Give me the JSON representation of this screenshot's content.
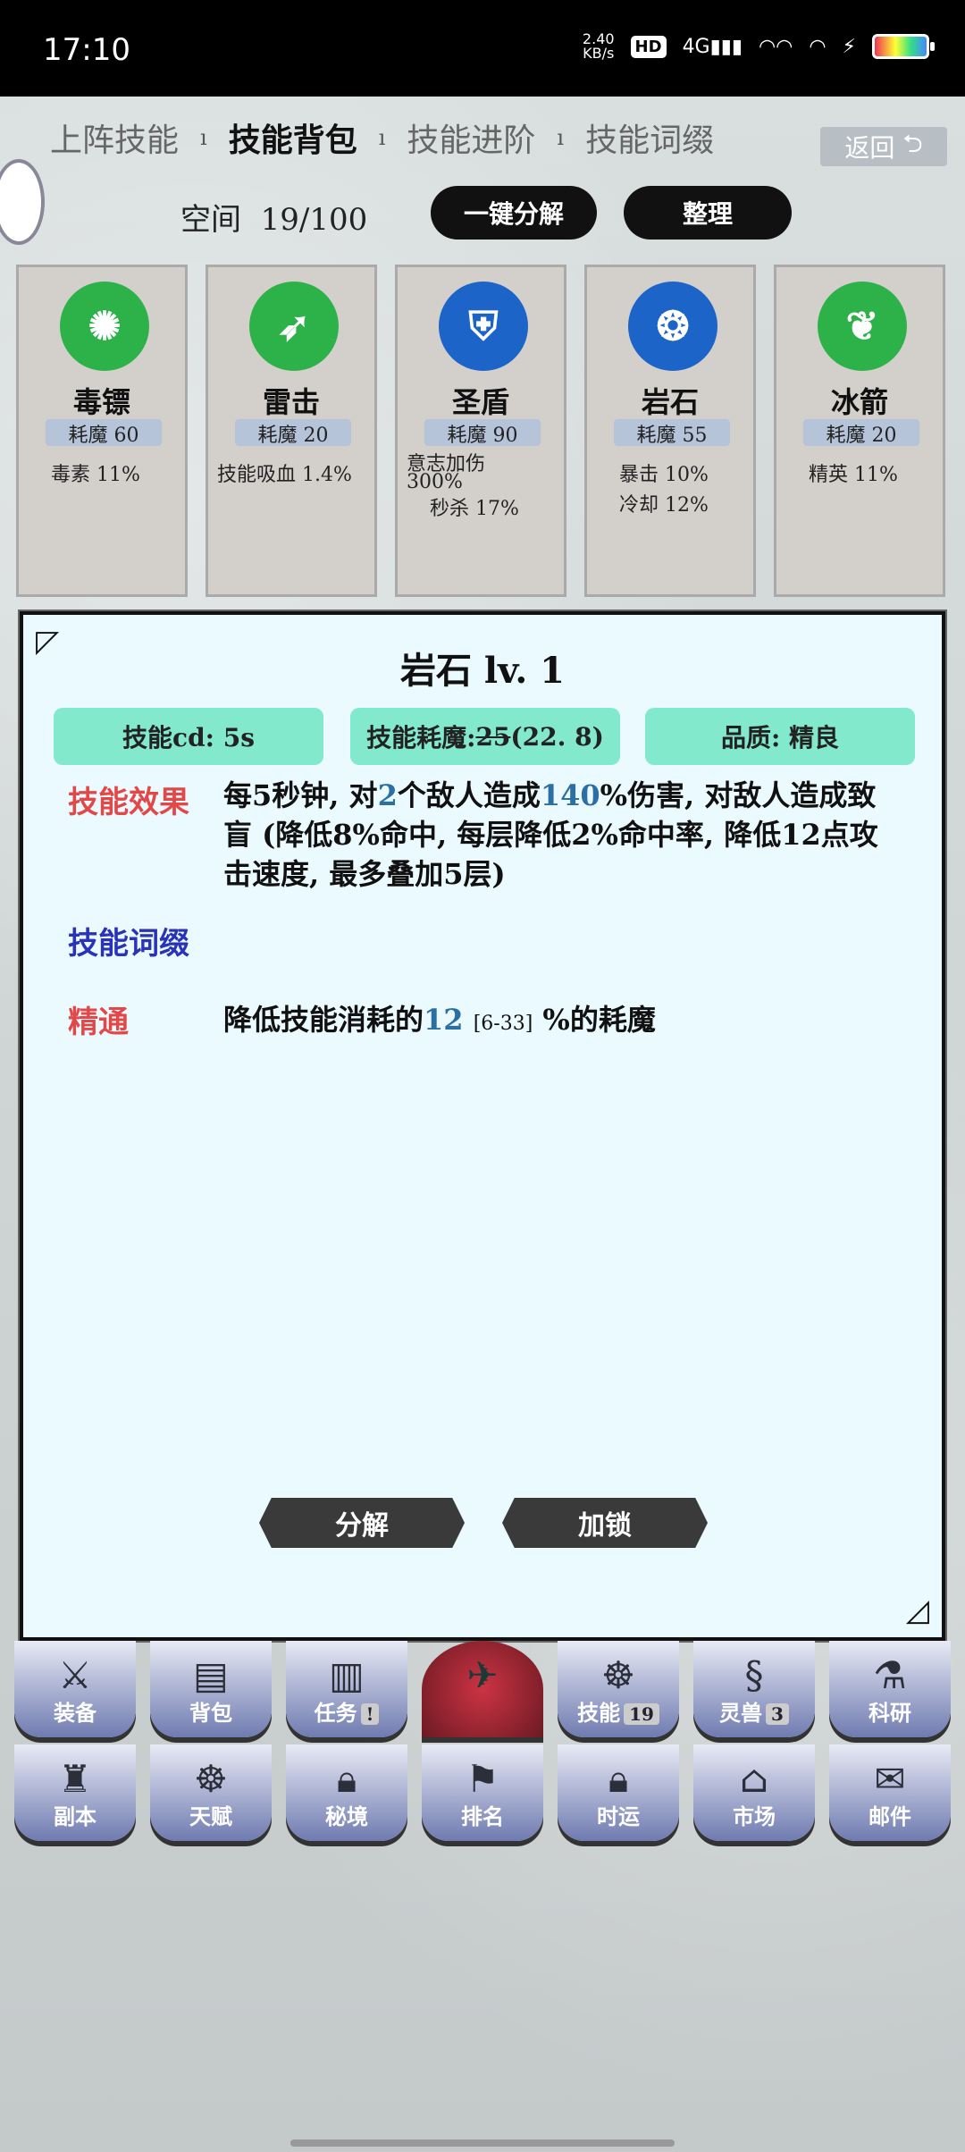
{
  "status": {
    "time": "17:10",
    "net_value": "2.40",
    "net_unit": "KB/s",
    "hd": "HD",
    "signal": "4G"
  },
  "tabs": [
    "上阵技能",
    "技能背包",
    "技能进阶",
    "技能词缀"
  ],
  "back_label": "返回",
  "space": {
    "label": "空间",
    "value": "19/100"
  },
  "buttons": {
    "decompose_all": "一键分解",
    "sort": "整理"
  },
  "cards": [
    {
      "name": "毒镖",
      "cost": "耗魔 60",
      "stats": [
        "毒素 11%"
      ],
      "color": "#2db24a"
    },
    {
      "name": "雷击",
      "cost": "耗魔 20",
      "stats": [
        "技能吸血 1.4%"
      ],
      "color": "#2db24a"
    },
    {
      "name": "圣盾",
      "cost": "耗魔 90",
      "stats": [
        "意志加伤",
        "300%",
        "秒杀 17%"
      ],
      "color": "#1d64c8"
    },
    {
      "name": "岩石",
      "cost": "耗魔 55",
      "stats": [
        "暴击 10%",
        "冷却 12%"
      ],
      "color": "#1d64c8"
    },
    {
      "name": "冰箭",
      "cost": "耗魔 20",
      "stats": [
        "精英 11%"
      ],
      "color": "#2db24a"
    }
  ],
  "detail": {
    "title": "岩石 lv. 1",
    "badges": {
      "cd": "技能cd: 5s",
      "cost_label": "技能耗魔:",
      "cost_old": "25",
      "cost_new": "(22. 8)",
      "quality": "品质: 精良"
    },
    "effect_label": "技能效果",
    "effect": {
      "p1": "每5秒钟, 对",
      "n1": "2",
      "p2": "个敌人造成",
      "n2": "140",
      "p3": "%伤害, 对敌人造成致盲 (降低8%命中, 每层降低2%命中率, 降低12点攻击速度, 最多叠加5层)"
    },
    "affix_label": "技能词缀",
    "mastery_label": "精通",
    "mastery": {
      "p1": "降低技能消耗的",
      "n1": "12",
      "range": "[6-33]",
      "p2": "%的耗魔"
    },
    "decompose": "分解",
    "lock": "加锁"
  },
  "menu_row1": [
    {
      "label": "装备",
      "badge": ""
    },
    {
      "label": "背包",
      "badge": ""
    },
    {
      "label": "任务",
      "badge": "!"
    },
    {
      "label": "",
      "badge": ""
    },
    {
      "label": "技能",
      "badge": "19"
    },
    {
      "label": "灵兽",
      "badge": "3"
    },
    {
      "label": "科研",
      "badge": ""
    }
  ],
  "menu_row2": [
    {
      "label": "副本",
      "badge": ""
    },
    {
      "label": "天赋",
      "badge": ""
    },
    {
      "label": "秘境",
      "badge": ""
    },
    {
      "label": "排名",
      "badge": ""
    },
    {
      "label": "时运",
      "badge": ""
    },
    {
      "label": "市场",
      "badge": ""
    },
    {
      "label": "邮件",
      "badge": ""
    }
  ]
}
